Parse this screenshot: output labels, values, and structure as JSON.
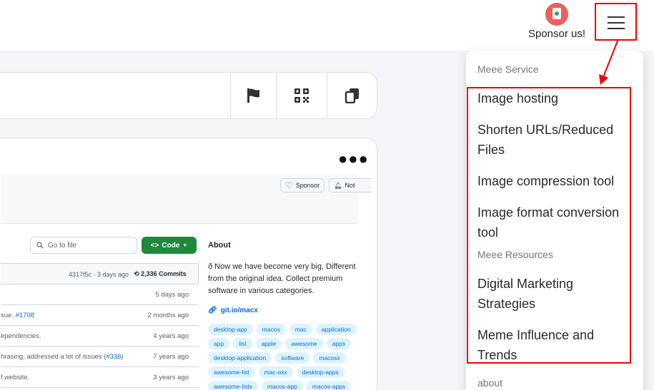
{
  "header": {
    "sponsor_label": "Sponsor us!",
    "sponsor_icon": "coffee-cup-icon",
    "menu_icon": "hamburger-menu-icon"
  },
  "url_bar": {
    "actions": [
      "flag-icon",
      "qr-code-icon",
      "copy-icon"
    ]
  },
  "repo_preview": {
    "sponsor_label": "Sponsor",
    "notify_label": "Not",
    "go_to_file_placeholder": "Go to file",
    "code_label": "Code",
    "commit_hash": "4317f5c · 3 days ago",
    "commit_count": "2,336 Commits",
    "rows": [
      {
        "message": "",
        "ago": "5 days ago"
      },
      {
        "message": "sue. ",
        "link": "#1708",
        "ago": "2 months ago"
      },
      {
        "message": "ependencies.",
        "ago": "4 years ago"
      },
      {
        "message": "hrasing, addressed a lot of issues (",
        "link": "#336",
        "tail": ")",
        "ago": "7 years ago"
      },
      {
        "message": "f website.",
        "ago": "3 years ago"
      }
    ],
    "about_title": "About",
    "about_desc": "ð Now we have become very big, Different from the original idea. Collect premium software in various categories.",
    "about_link": "git.io/macx",
    "tags": [
      "desktop-app",
      "macos",
      "mac",
      "application",
      "app",
      "list",
      "apple",
      "awesome",
      "apps",
      "desktop-application",
      "software",
      "macosx",
      "awesome-list",
      "mac-osx",
      "desktop-apps",
      "awesome-lists",
      "macos-app",
      "macos-apps"
    ]
  },
  "dropdown": {
    "section_service": "Meee Service",
    "service_items": [
      "Image hosting",
      "Shorten URLs/Reduced Files",
      "Image compression tool",
      "Image format conversion tool"
    ],
    "section_resources": "Meee Resources",
    "resource_items": [
      "Digital Marketing Strategies",
      "Meme Influence and Trends"
    ],
    "section_about": "about"
  },
  "colors": {
    "highlight": "#ee0000",
    "code_button": "#1f883d",
    "link": "#0969da",
    "sponsor_badge": "#e8615b"
  }
}
